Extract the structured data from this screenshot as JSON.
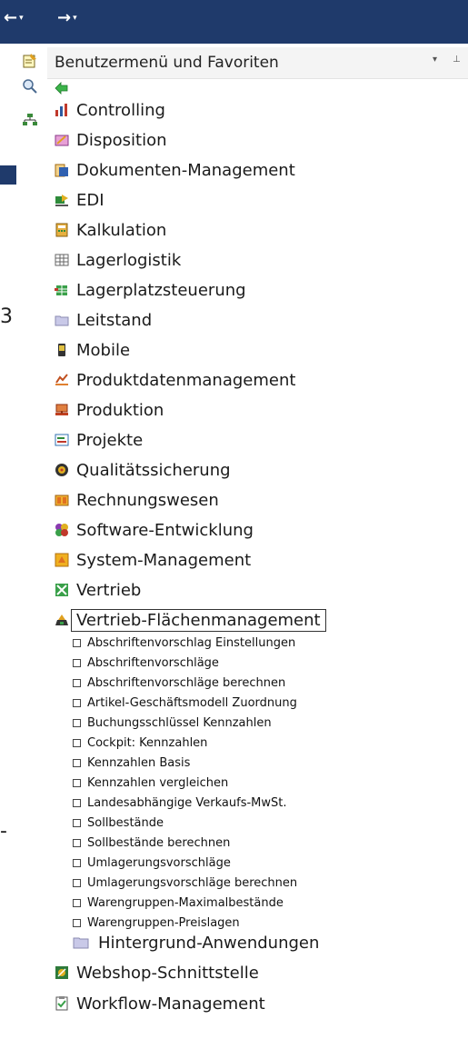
{
  "nav": {
    "back_arrow": "←",
    "forward_arrow": "→",
    "dropdown": "▾"
  },
  "panel": {
    "title": "Benutzermenü und Favoriten",
    "menu_button": "▾",
    "pin_button": "⊥"
  },
  "edge_marks": {
    "upper": "3",
    "lower": "-"
  },
  "menu_items": [
    {
      "label": "Controlling",
      "icon": "chart-icon"
    },
    {
      "label": "Disposition",
      "icon": "disposition-icon"
    },
    {
      "label": "Dokumenten-Management",
      "icon": "document-icon"
    },
    {
      "label": "EDI",
      "icon": "edi-icon"
    },
    {
      "label": "Kalkulation",
      "icon": "calculator-icon"
    },
    {
      "label": "Lagerlogistik",
      "icon": "grid-icon"
    },
    {
      "label": "Lagerplatzsteuerung",
      "icon": "warehouse-icon"
    },
    {
      "label": "Leitstand",
      "icon": "folder-icon"
    },
    {
      "label": "Mobile",
      "icon": "mobile-icon"
    },
    {
      "label": "Produktdatenmanagement",
      "icon": "product-icon"
    },
    {
      "label": "Produktion",
      "icon": "production-icon"
    },
    {
      "label": "Projekte",
      "icon": "project-icon"
    },
    {
      "label": "Qualitätssicherung",
      "icon": "quality-icon"
    },
    {
      "label": "Rechnungswesen",
      "icon": "accounting-icon"
    },
    {
      "label": "Software-Entwicklung",
      "icon": "software-icon"
    },
    {
      "label": "System-Management",
      "icon": "system-icon"
    },
    {
      "label": "Vertrieb",
      "icon": "sales-icon"
    },
    {
      "label": "Vertrieb-Flächenmanagement",
      "icon": "area-management-icon",
      "selected": true
    }
  ],
  "sub_items": [
    "Abschriftenvorschlag Einstellungen",
    "Abschriftenvorschläge",
    "Abschriftenvorschläge berechnen",
    "Artikel-Geschäftsmodell Zuordnung",
    "Buchungsschlüssel Kennzahlen",
    "Cockpit: Kennzahlen",
    "Kennzahlen Basis",
    "Kennzahlen vergleichen",
    "Landesabhängige Verkaufs-MwSt.",
    "Sollbestände",
    "Sollbestände berechnen",
    "Umlagerungsvorschläge",
    "Umlagerungsvorschläge berechnen",
    "Warengruppen-Maximalbestände",
    "Warengruppen-Preislagen"
  ],
  "sub_folder": {
    "label": "Hintergrund-Anwendungen",
    "icon": "folder-icon"
  },
  "bottom_items": [
    {
      "label": "Webshop-Schnittstelle",
      "icon": "webshop-icon"
    },
    {
      "label": "Workflow-Management",
      "icon": "workflow-icon"
    }
  ],
  "colors": {
    "topbar": "#1f3a6b",
    "header_bg": "#f4f4f4"
  }
}
